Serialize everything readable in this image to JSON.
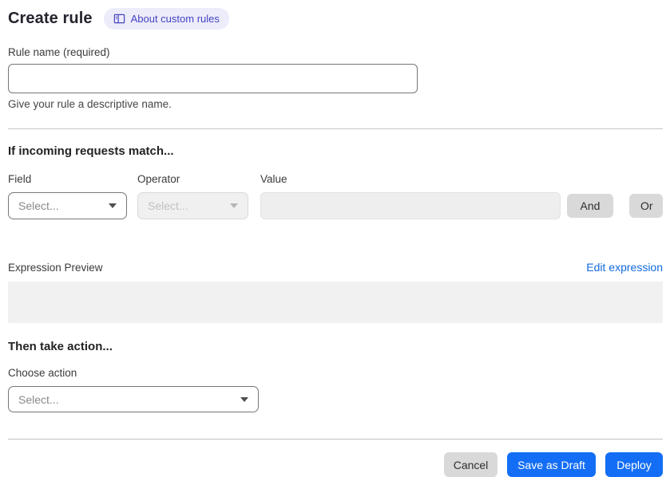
{
  "page": {
    "title": "Create rule",
    "about_link_label": "About custom rules"
  },
  "rule_name": {
    "label": "Rule name (required)",
    "value": "",
    "helper": "Give your rule a descriptive name."
  },
  "match_section": {
    "heading": "If incoming requests match...",
    "field": {
      "label": "Field",
      "selected": "Select...",
      "enabled": true
    },
    "operator": {
      "label": "Operator",
      "selected": "Select...",
      "enabled": false
    },
    "value": {
      "label": "Value",
      "value": "",
      "enabled": false
    },
    "and_button_label": "And",
    "or_button_label": "Or",
    "expression_preview_label": "Expression Preview",
    "edit_expression_label": "Edit expression",
    "expression_value": ""
  },
  "action_section": {
    "heading": "Then take action...",
    "choose_action_label": "Choose action",
    "selected": "Select..."
  },
  "footer": {
    "cancel_label": "Cancel",
    "save_draft_label": "Save as Draft",
    "deploy_label": "Deploy"
  },
  "icons": {
    "book_icon": "documentation-book",
    "chevron_down": "dropdown-caret"
  },
  "colors": {
    "primary_blue": "#146ef5",
    "link_blue": "#1269db",
    "badge_bg": "#edecfa",
    "badge_text": "#4343c2",
    "disabled_bg": "#f0f0f0",
    "neutral_button_bg": "#d9d9d9",
    "expression_box_bg": "#f1f1f1",
    "divider": "#c6c6c6"
  }
}
